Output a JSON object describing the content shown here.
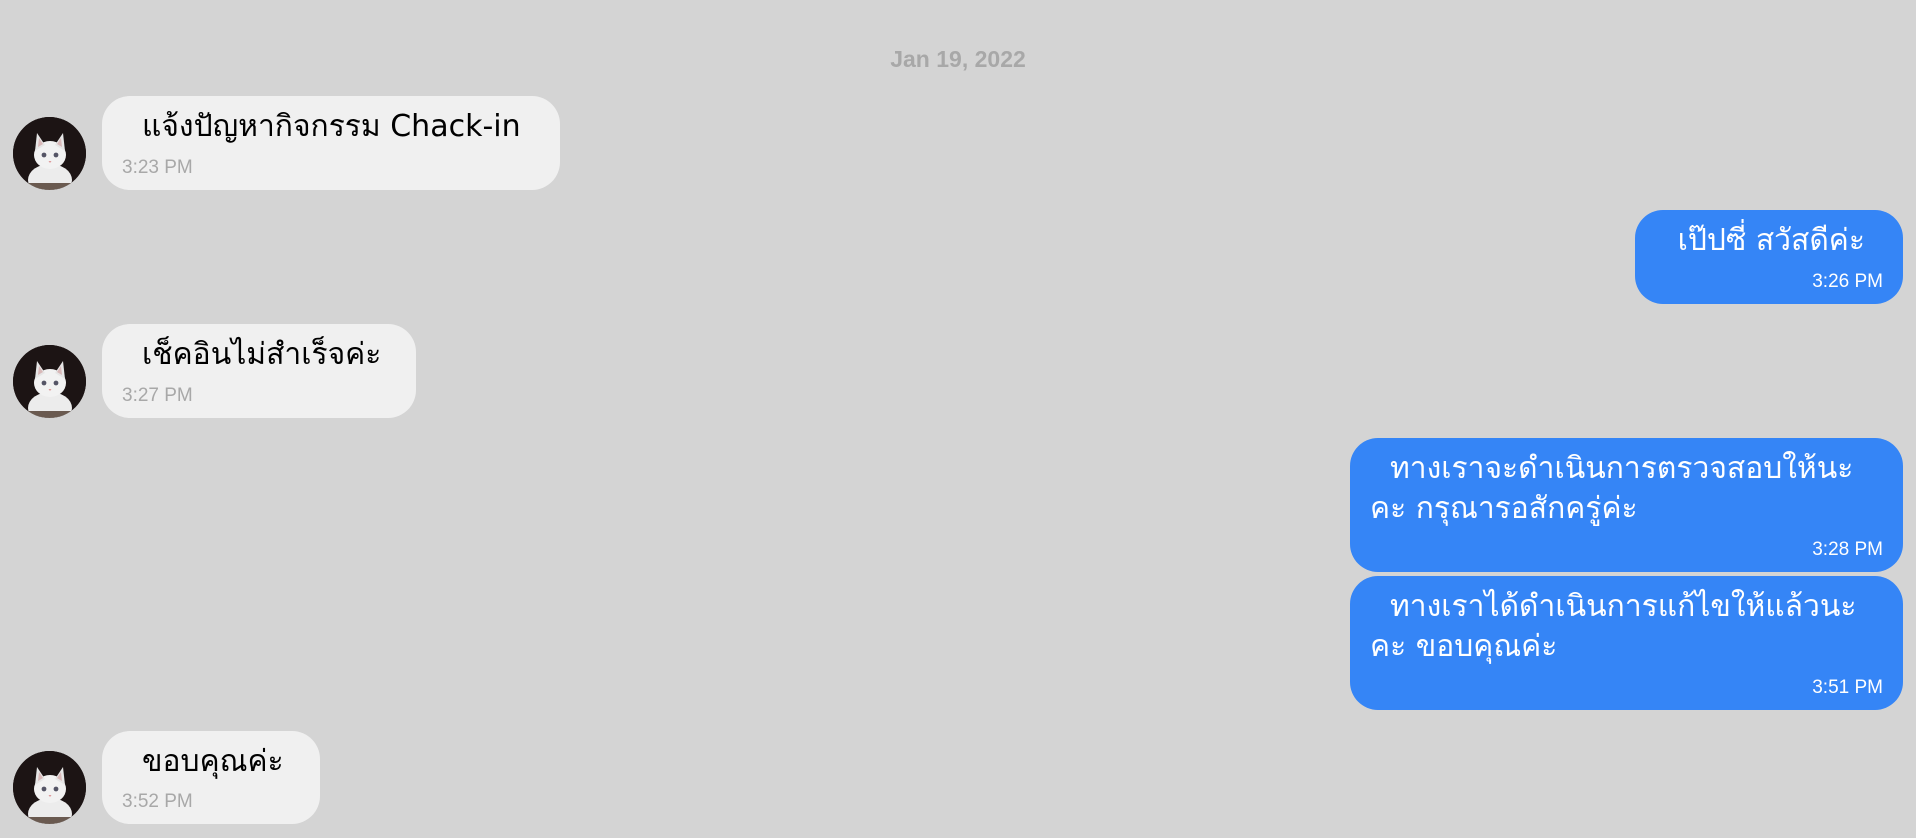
{
  "date_divider": "Jan 19, 2022",
  "colors": {
    "background": "#d4d4d4",
    "incoming_bubble": "#f0f0f0",
    "outgoing_bubble": "#3585f6"
  },
  "contact": {
    "avatar_icon": "cat-avatar-icon"
  },
  "messages": [
    {
      "direction": "incoming",
      "text": "แจ้งปัญหากิจกรรม Chack-in",
      "time": "3:23 PM"
    },
    {
      "direction": "outgoing",
      "text": "เป๊ปซี่ สวัสดีค่ะ",
      "time": "3:26 PM"
    },
    {
      "direction": "incoming",
      "text": "เช็คอินไม่สำเร็จค่ะ",
      "time": "3:27 PM"
    },
    {
      "direction": "outgoing",
      "text": "ทางเราจะดำเนินการตรวจสอบให้นะคะ กรุณารอสักครู่ค่ะ",
      "time": "3:28 PM"
    },
    {
      "direction": "outgoing",
      "text": "ทางเราได้ดำเนินการแก้ไขให้แล้วนะคะ ขอบคุณค่ะ",
      "time": "3:51 PM"
    },
    {
      "direction": "incoming",
      "text": "ขอบคุณค่ะ",
      "time": "3:52 PM"
    }
  ]
}
